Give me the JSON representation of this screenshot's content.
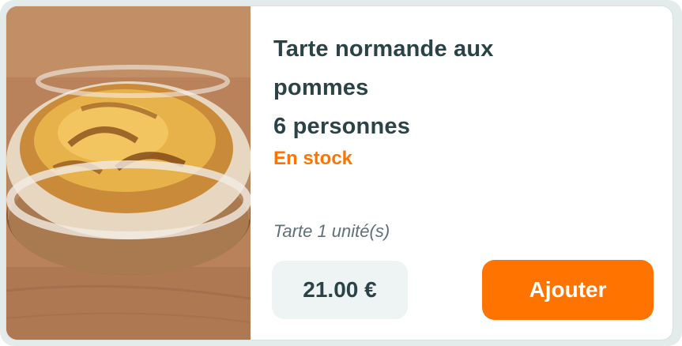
{
  "product": {
    "name_line1": "Tarte normande aux",
    "name_line2": "pommes",
    "name_line3": "6 personnes",
    "stock_status": "En stock",
    "unit": "Tarte 1 unité(s)",
    "price": "21.00 €",
    "add_label": "Ajouter",
    "image_icon": "tart-photo"
  },
  "colors": {
    "accent": "#ff7300",
    "title": "#2b4347",
    "price_bg": "#eef3f3"
  }
}
